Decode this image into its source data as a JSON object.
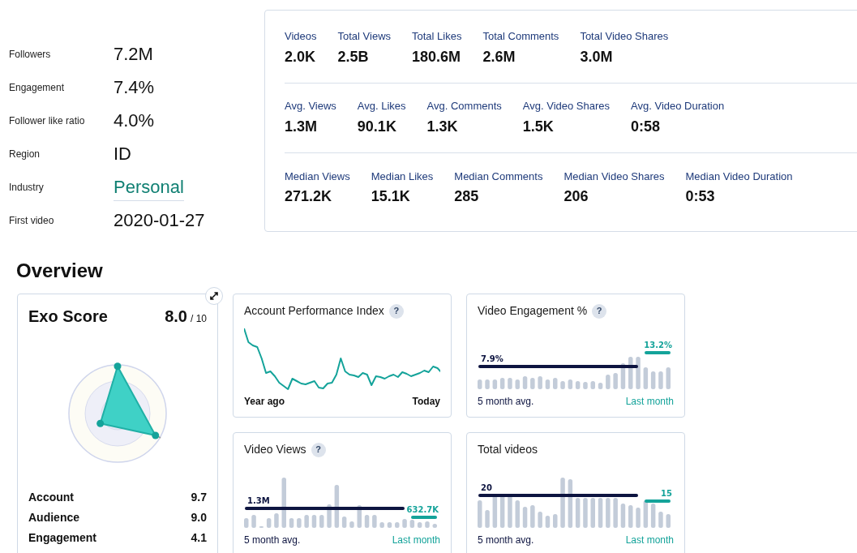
{
  "profile": [
    {
      "label": "Followers",
      "value": "7.2M",
      "kind": "plain"
    },
    {
      "label": "Engagement",
      "value": "7.4%",
      "kind": "plain"
    },
    {
      "label": "Follower like ratio",
      "value": "4.0%",
      "kind": "plain"
    },
    {
      "label": "Region",
      "value": "ID",
      "kind": "plain"
    },
    {
      "label": "Industry",
      "value": "Personal",
      "kind": "link"
    },
    {
      "label": "First video",
      "value": "2020-01-27",
      "kind": "plain"
    }
  ],
  "stats_rows": [
    [
      {
        "label": "Videos",
        "value": "2.0K"
      },
      {
        "label": "Total Views",
        "value": "2.5B"
      },
      {
        "label": "Total Likes",
        "value": "180.6M"
      },
      {
        "label": "Total Comments",
        "value": "2.6M"
      },
      {
        "label": "Total Video Shares",
        "value": "3.0M"
      }
    ],
    [
      {
        "label": "Avg. Views",
        "value": "1.3M"
      },
      {
        "label": "Avg. Likes",
        "value": "90.1K"
      },
      {
        "label": "Avg. Comments",
        "value": "1.3K"
      },
      {
        "label": "Avg. Video Shares",
        "value": "1.5K"
      },
      {
        "label": "Avg. Video Duration",
        "value": "0:58"
      }
    ],
    [
      {
        "label": "Median Views",
        "value": "271.2K"
      },
      {
        "label": "Median Likes",
        "value": "15.1K"
      },
      {
        "label": "Median Comments",
        "value": "285"
      },
      {
        "label": "Median Video Shares",
        "value": "206"
      },
      {
        "label": "Median Video Duration",
        "value": "0:53"
      }
    ]
  ],
  "overview": {
    "title": "Overview",
    "exo_score": {
      "title": "Exo Score",
      "score": "8.0",
      "max": "/ 10",
      "parts": [
        {
          "label": "Account",
          "value": "9.7"
        },
        {
          "label": "Audience",
          "value": "9.0"
        },
        {
          "label": "Engagement",
          "value": "4.1"
        }
      ]
    },
    "cards": [
      {
        "kind": "line",
        "title": "Account Performance Index",
        "help": "?",
        "start_label": "Year ago",
        "end_label": "Today"
      },
      {
        "kind": "bars",
        "title": "Video Engagement %",
        "help": "?",
        "avg_value": "7.9%",
        "last_value": "13.2%",
        "avg_label": "5 month avg.",
        "last_label": "Last month"
      },
      {
        "kind": "bars",
        "title": "Video Views",
        "help": "?",
        "avg_value": "1.3M",
        "last_value": "632.7K",
        "avg_label": "5 month avg.",
        "last_label": "Last month"
      },
      {
        "kind": "bars",
        "title": "Total videos",
        "avg_value": "20",
        "last_value": "15",
        "avg_label": "5 month avg.",
        "last_label": "Last month"
      }
    ]
  }
}
